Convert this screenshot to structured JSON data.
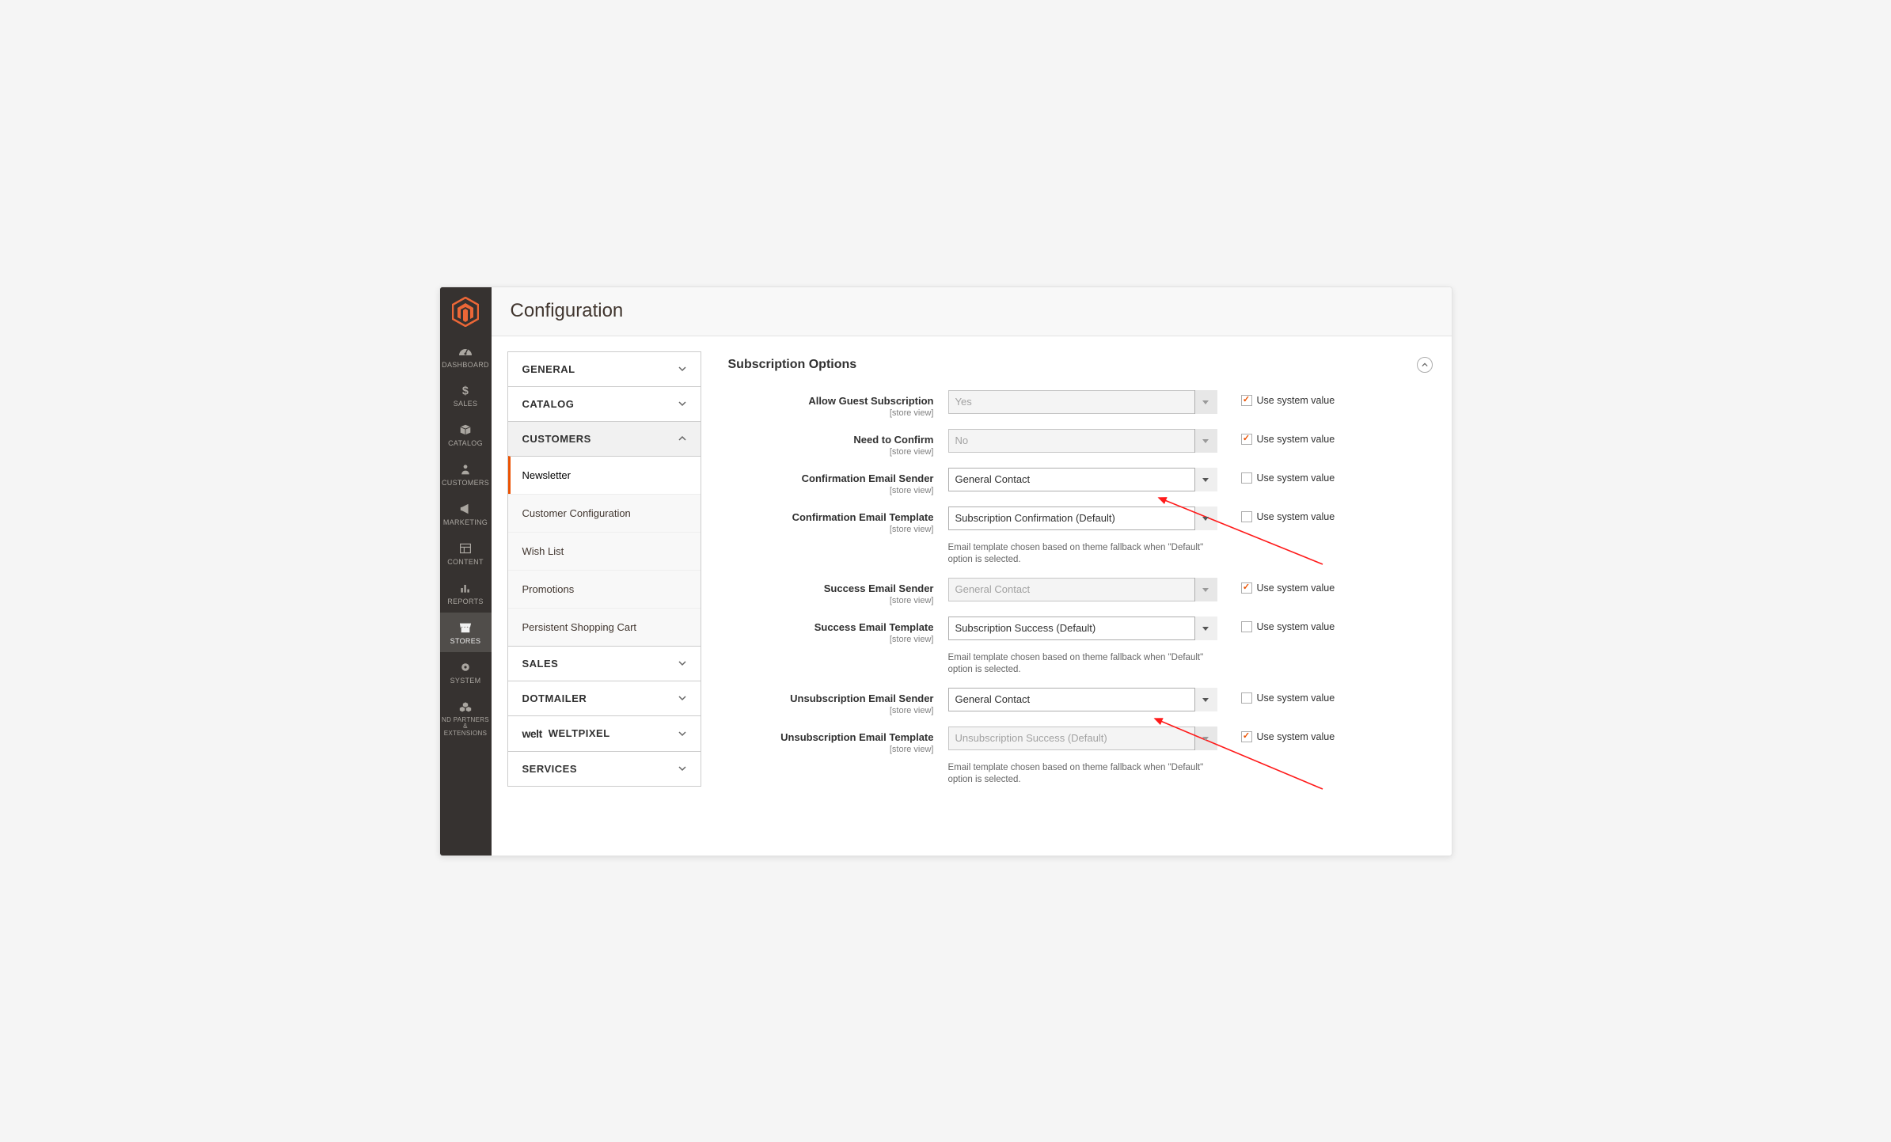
{
  "header": {
    "title": "Configuration"
  },
  "rail": {
    "items": [
      {
        "id": "dashboard",
        "label": "DASHBOARD"
      },
      {
        "id": "sales",
        "label": "SALES"
      },
      {
        "id": "catalog",
        "label": "CATALOG"
      },
      {
        "id": "customers",
        "label": "CUSTOMERS"
      },
      {
        "id": "marketing",
        "label": "MARKETING"
      },
      {
        "id": "content",
        "label": "CONTENT"
      },
      {
        "id": "reports",
        "label": "REPORTS"
      },
      {
        "id": "stores",
        "label": "STORES"
      },
      {
        "id": "system",
        "label": "SYSTEM"
      },
      {
        "id": "partners",
        "label": "ND PARTNERS & EXTENSIONS"
      }
    ]
  },
  "configTabs": {
    "general": "GENERAL",
    "catalog": "CATALOG",
    "customers": "CUSTOMERS",
    "sales": "SALES",
    "dotmailer": "DOTMAILER",
    "weltpixel": "WELTPIXEL",
    "weltpixel_brand": "welt",
    "services": "SERVICES",
    "customersSub": [
      "Newsletter",
      "Customer Configuration",
      "Wish List",
      "Promotions",
      "Persistent Shopping Cart"
    ]
  },
  "section": {
    "title": "Subscription Options",
    "scopeText": "[store view]",
    "useSystem": "Use system value",
    "hint": "Email template chosen based on theme fallback when \"Default\" option is selected.",
    "fields": {
      "allowGuest": {
        "label": "Allow Guest Subscription",
        "value": "Yes",
        "disabled": true,
        "useSystem": true,
        "hint": false
      },
      "needConfirm": {
        "label": "Need to Confirm",
        "value": "No",
        "disabled": true,
        "useSystem": true,
        "hint": false
      },
      "confSender": {
        "label": "Confirmation Email Sender",
        "value": "General Contact",
        "disabled": false,
        "useSystem": false,
        "hint": false
      },
      "confTemplate": {
        "label": "Confirmation Email Template",
        "value": "Subscription Confirmation (Default)",
        "disabled": false,
        "useSystem": false,
        "hint": true
      },
      "succSender": {
        "label": "Success Email Sender",
        "value": "General Contact",
        "disabled": true,
        "useSystem": true,
        "hint": false
      },
      "succTemplate": {
        "label": "Success Email Template",
        "value": "Subscription Success (Default)",
        "disabled": false,
        "useSystem": false,
        "hint": true
      },
      "unsubSender": {
        "label": "Unsubscription Email Sender",
        "value": "General Contact",
        "disabled": false,
        "useSystem": false,
        "hint": false
      },
      "unsubTemplate": {
        "label": "Unsubscription Email Template",
        "value": "Unsubscription Success (Default)",
        "disabled": true,
        "useSystem": true,
        "hint": true
      }
    }
  }
}
